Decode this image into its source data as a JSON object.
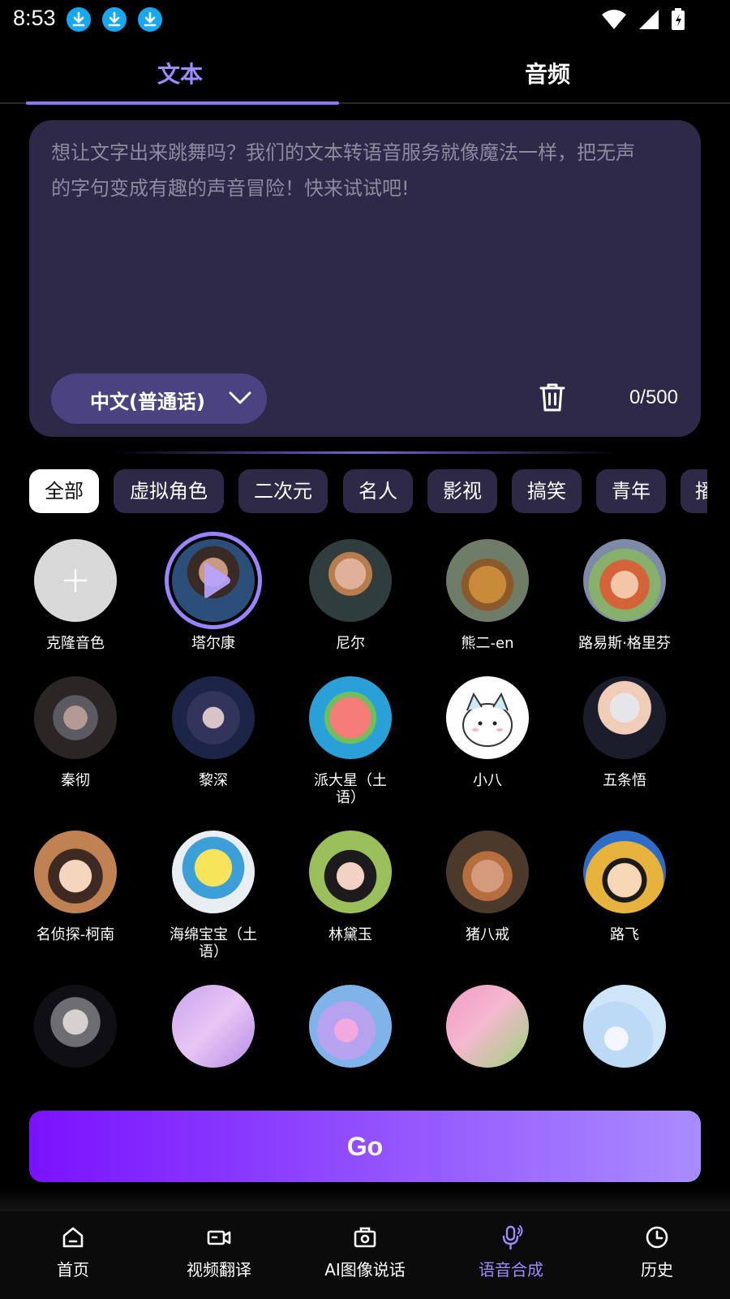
{
  "status_bar": {
    "time": "8:53"
  },
  "tabs": [
    {
      "label": "文本",
      "active": true
    },
    {
      "label": "音频",
      "active": false
    }
  ],
  "editor": {
    "placeholder_line1": "想让文字出来跳舞吗？我们的文本转语音服务就像魔法一样，把无声",
    "placeholder_line2": "的字句变成有趣的声音冒险！快来试试吧!",
    "language": "中文(普通话)",
    "counter": "0/500"
  },
  "categories": [
    {
      "label": "全部",
      "active": true
    },
    {
      "label": "虚拟角色"
    },
    {
      "label": "二次元"
    },
    {
      "label": "名人"
    },
    {
      "label": "影视"
    },
    {
      "label": "搞笑"
    },
    {
      "label": "青年"
    },
    {
      "label": "播"
    }
  ],
  "voices": [
    {
      "name": "克隆音色",
      "kind": "add",
      "icon": "plus-icon"
    },
    {
      "name": "塔尔康",
      "selected": true,
      "icon": "play-icon"
    },
    {
      "name": "尼尔"
    },
    {
      "name": "熊二-en"
    },
    {
      "name": "路易斯·格里芬"
    },
    {
      "name": "秦彻"
    },
    {
      "name": "黎深"
    },
    {
      "name": "派大星（土",
      "name2": "语）"
    },
    {
      "name": "小八"
    },
    {
      "name": "五条悟"
    },
    {
      "name": "名侦探-柯南"
    },
    {
      "name": "海绵宝宝（土",
      "name2": "语）"
    },
    {
      "name": "林黛玉"
    },
    {
      "name": "猪八戒"
    },
    {
      "name": "路飞"
    },
    {
      "name": ""
    },
    {
      "name": ""
    },
    {
      "name": ""
    },
    {
      "name": ""
    },
    {
      "name": ""
    }
  ],
  "go_button": {
    "label": "Go"
  },
  "bottom_nav": [
    {
      "label": "首页",
      "icon": "home-icon"
    },
    {
      "label": "视频翻译",
      "icon": "video-camera-icon"
    },
    {
      "label": "AI图像说话",
      "icon": "photo-camera-icon"
    },
    {
      "label": "语音合成",
      "icon": "microphone-icon",
      "active": true
    },
    {
      "label": "历史",
      "icon": "clock-icon"
    }
  ],
  "colors": {
    "accent": "#9b8cff",
    "card": "#2e2849",
    "chip": "#2f2948",
    "go_start": "#7a12ff",
    "go_end": "#a98cff"
  }
}
